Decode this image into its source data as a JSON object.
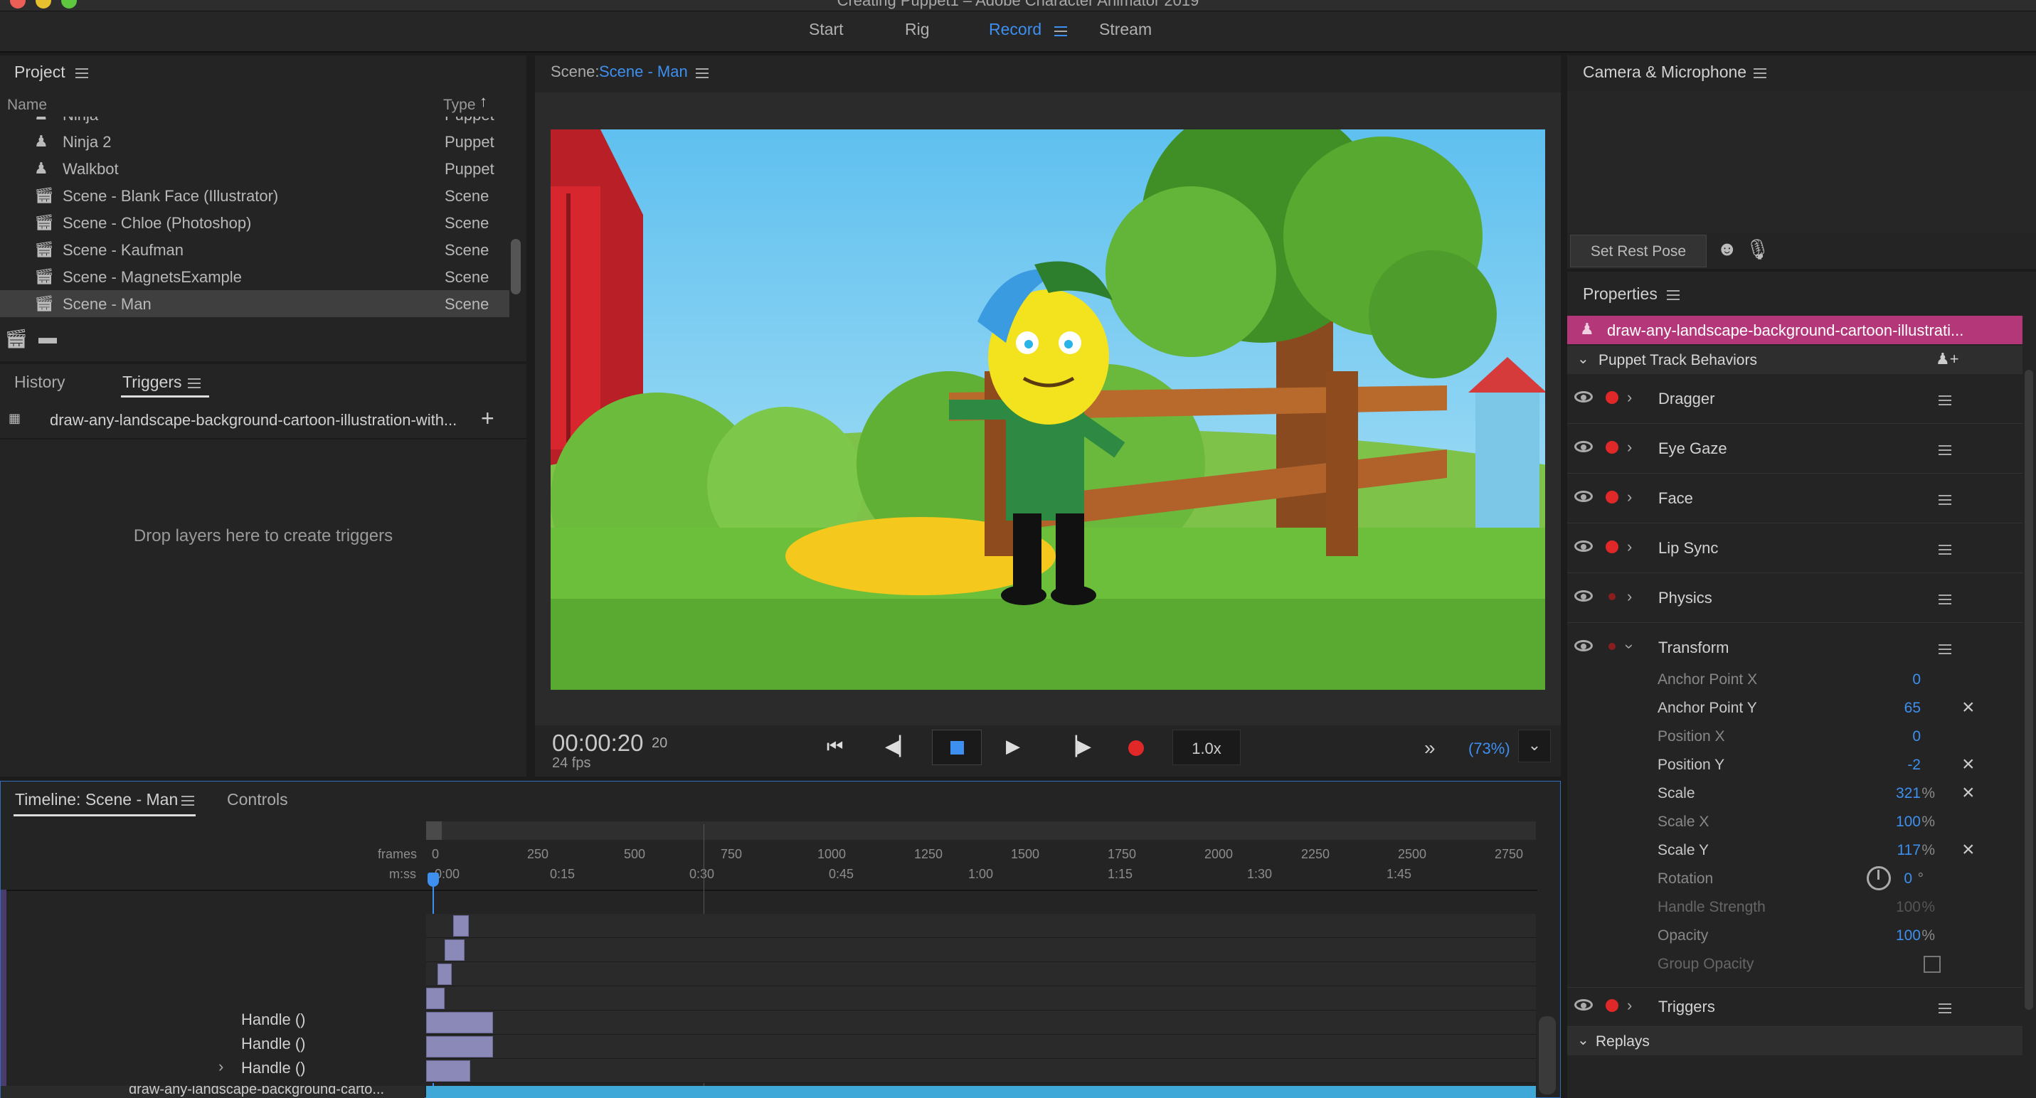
{
  "app": {
    "title": "Creating Puppet1 – Adobe Character Animator 2019"
  },
  "modes": [
    {
      "label": "Start"
    },
    {
      "label": "Rig"
    },
    {
      "label": "Record"
    },
    {
      "label": "Stream"
    }
  ],
  "colors": {
    "accent": "#3d8ff0",
    "record": "#e02828",
    "selected_layer": "#b4377a",
    "timeline_bar": "#3fa8d8"
  },
  "project": {
    "title": "Project",
    "col_name": "Name",
    "col_type": "Type",
    "items": [
      {
        "name": "Ninja",
        "type": "Puppet",
        "icon": "puppet-icon"
      },
      {
        "name": "Ninja 2",
        "type": "Puppet",
        "icon": "puppet-icon"
      },
      {
        "name": "Walkbot",
        "type": "Puppet",
        "icon": "puppet-icon"
      },
      {
        "name": "Scene - Blank Face (Illustrator)",
        "type": "Scene",
        "icon": "scene-icon"
      },
      {
        "name": "Scene - Chloe (Photoshop)",
        "type": "Scene",
        "icon": "scene-icon"
      },
      {
        "name": "Scene - Kaufman",
        "type": "Scene",
        "icon": "scene-icon"
      },
      {
        "name": "Scene - MagnetsExample",
        "type": "Scene",
        "icon": "scene-icon"
      },
      {
        "name": "Scene - Man",
        "type": "Scene",
        "icon": "scene-icon"
      }
    ]
  },
  "triggers": {
    "tab_history": "History",
    "tab_triggers": "Triggers",
    "layer": "draw-any-landscape-background-cartoon-illustration-with...",
    "drop_hint": "Drop layers here to create triggers"
  },
  "scene": {
    "label": "Scene:",
    "name": "Scene - Man"
  },
  "transport": {
    "timecode": "00:00:20",
    "frame": "20",
    "fps": "24 fps",
    "speed": "1.0x",
    "zoom": "(73%)"
  },
  "camera": {
    "title": "Camera & Microphone",
    "set_rest_pose": "Set Rest Pose"
  },
  "properties": {
    "title": "Properties",
    "layer": "draw-any-landscape-background-cartoon-illustrati...",
    "section": "Puppet Track Behaviors",
    "behaviors": [
      {
        "name": "Dragger"
      },
      {
        "name": "Eye Gaze"
      },
      {
        "name": "Face"
      },
      {
        "name": "Lip Sync"
      },
      {
        "name": "Physics"
      },
      {
        "name": "Transform"
      }
    ],
    "transform_params": [
      {
        "label": "Anchor Point X",
        "value": "0",
        "unit": ""
      },
      {
        "label": "Anchor Point Y",
        "value": "65",
        "unit": ""
      },
      {
        "label": "Position X",
        "value": "0",
        "unit": ""
      },
      {
        "label": "Position Y",
        "value": "-2",
        "unit": ""
      },
      {
        "label": "Scale",
        "value": "321",
        "unit": "%"
      },
      {
        "label": "Scale X",
        "value": "100",
        "unit": "%"
      },
      {
        "label": "Scale Y",
        "value": "117",
        "unit": "%"
      },
      {
        "label": "Rotation",
        "value": "0",
        "unit": "°"
      },
      {
        "label": "Handle Strength",
        "value": "100",
        "unit": "%"
      },
      {
        "label": "Opacity",
        "value": "100",
        "unit": "%"
      },
      {
        "label": "Group Opacity",
        "value": "",
        "unit": ""
      }
    ],
    "triggers": "Triggers",
    "replays": "Replays"
  },
  "timeline": {
    "title": "Timeline: Scene - Man",
    "controls": "Controls",
    "frames_label": "frames",
    "mss_label": "m:ss",
    "frame_ticks": [
      "0",
      "250",
      "500",
      "750",
      "1000",
      "1250",
      "1500",
      "1750",
      "2000",
      "2250",
      "2500",
      "2750"
    ],
    "time_ticks": [
      "0:00",
      "0:15",
      "0:30",
      "0:45",
      "1:00",
      "1:15",
      "1:30",
      "1:45"
    ],
    "handles": [
      "Handle ()",
      "Handle ()",
      "Handle ()"
    ],
    "bottom_layer": "draw-any-landscape-background-carto..."
  }
}
